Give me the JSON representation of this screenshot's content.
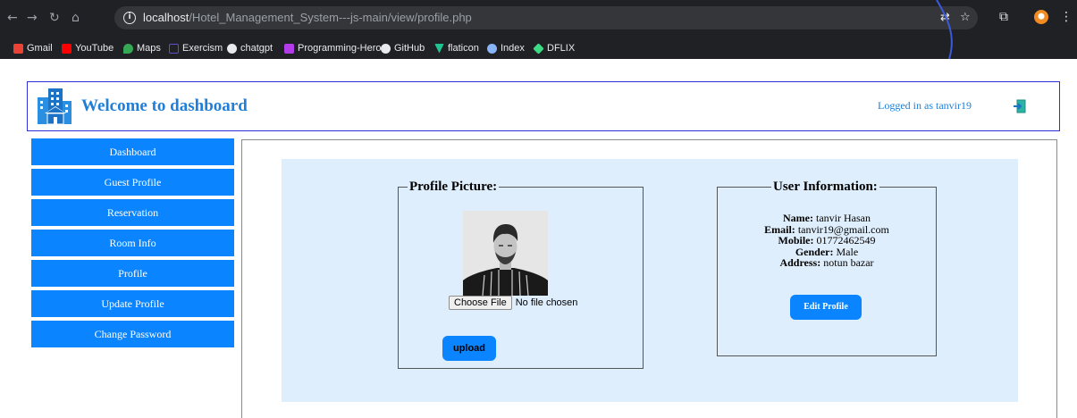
{
  "browser": {
    "url_host": "localhost",
    "url_path": "/Hotel_Management_System---js-main/view/profile.php",
    "bookmarks": [
      {
        "label": "Gmail",
        "icon": "gmail-icon",
        "color": "#ea4335"
      },
      {
        "label": "YouTube",
        "icon": "youtube-icon",
        "color": "#ff0000"
      },
      {
        "label": "Maps",
        "icon": "maps-pin-icon",
        "color": "#34a853"
      },
      {
        "label": "Exercism",
        "icon": "exercism-icon",
        "color": "#604fcd"
      },
      {
        "label": "chatgpt",
        "icon": "chatgpt-icon",
        "color": "#e8eaed"
      },
      {
        "label": "Programming-Hero",
        "icon": "programming-hero-icon",
        "color": "#b23ce8"
      },
      {
        "label": "GitHub",
        "icon": "github-icon",
        "color": "#e8eaed"
      },
      {
        "label": "flaticon",
        "icon": "flaticon-icon",
        "color": "#1fc58e"
      },
      {
        "label": "Index",
        "icon": "index-icon",
        "color": "#8ab4f8"
      },
      {
        "label": "DFLIX",
        "icon": "dflix-icon",
        "color": "#3ddc84"
      }
    ]
  },
  "header": {
    "title": "Welcome to dashboard",
    "logged_in": "Logged in as tanvir19",
    "accent": "#1f7fd8",
    "border": "#2f2fd8"
  },
  "sidebar": {
    "items": [
      {
        "label": "Dashboard"
      },
      {
        "label": "Guest Profile"
      },
      {
        "label": "Reservation"
      },
      {
        "label": "Room Info"
      },
      {
        "label": "Profile"
      },
      {
        "label": "Update Profile"
      },
      {
        "label": "Change Password"
      }
    ],
    "button_color": "#0a84ff"
  },
  "profile_picture": {
    "legend": "Profile Picture:",
    "choose_file_label": "Choose File",
    "file_status": "No file chosen",
    "upload_label": "upload"
  },
  "user_info": {
    "legend": "User Information:",
    "fields": [
      {
        "label": "Name:",
        "value": "tanvir Hasan"
      },
      {
        "label": "Email:",
        "value": "tanvir19@gmail.com"
      },
      {
        "label": "Mobile:",
        "value": "01772462549"
      },
      {
        "label": "Gender:",
        "value": "Male"
      },
      {
        "label": "Address:",
        "value": "notun bazar"
      }
    ],
    "edit_label": "Edit Profile"
  },
  "colors": {
    "panel_bg": "#dfeefc",
    "chrome_bg": "#202124"
  }
}
